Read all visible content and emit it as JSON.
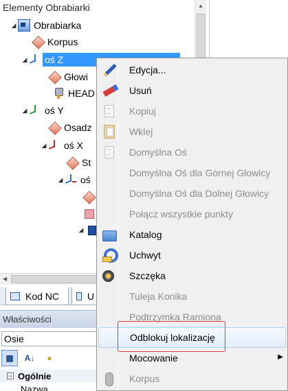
{
  "tree_panel": {
    "title": "Elementy Obrabiarki",
    "nodes": [
      {
        "label": "Obrabiarka"
      },
      {
        "label": "Korpus"
      },
      {
        "label": "oś Z"
      },
      {
        "label": "Głowi"
      },
      {
        "label": "HEAD"
      },
      {
        "label": "oś Y"
      },
      {
        "label": "Osadz"
      },
      {
        "label": "oś X"
      },
      {
        "label": "St"
      },
      {
        "label": "oś"
      }
    ]
  },
  "tabs": [
    {
      "label": "Kod NC"
    },
    {
      "label": "U"
    }
  ],
  "properties": {
    "title": "Właściwości",
    "combo_value": "Osie",
    "category": "Ogólnie",
    "first_item": "Nazwa"
  },
  "context_menu": {
    "items": [
      {
        "label": "Edycja...",
        "icon": "pencil-icon",
        "enabled": true
      },
      {
        "label": "Usuń",
        "icon": "eraser-icon",
        "enabled": true
      },
      {
        "label": "Kopiuj",
        "icon": "copy-icon",
        "enabled": false
      },
      {
        "label": "Wklej",
        "icon": "paste-icon",
        "enabled": false
      },
      {
        "label": "Domyślna Oś",
        "icon": "document-icon",
        "enabled": false
      },
      {
        "label": "Domyślna Oś dla Górnej Głowicy",
        "icon": "",
        "enabled": false
      },
      {
        "label": "Domyślna Oś dla Dolnej Głowicy",
        "icon": "",
        "enabled": false
      },
      {
        "label": "Połącz wszystkie punkty",
        "icon": "",
        "enabled": false
      },
      {
        "label": "Katalog",
        "icon": "folder-icon",
        "enabled": true
      },
      {
        "label": "Uchwyt",
        "icon": "magnet-icon",
        "enabled": true
      },
      {
        "label": "Szczęka",
        "icon": "chuck-icon",
        "enabled": true
      },
      {
        "label": "Tuleja Konika",
        "icon": "",
        "enabled": false
      },
      {
        "label": "Podtrzymka Ramiona",
        "icon": "",
        "enabled": false
      },
      {
        "label": "Odblokuj lokalizację",
        "icon": "",
        "enabled": true,
        "highlighted": true
      },
      {
        "label": "Mocowanie",
        "icon": "",
        "enabled": true,
        "submenu": true
      },
      {
        "label": "Korpus",
        "icon": "korpus-icon",
        "enabled": false
      }
    ]
  },
  "colors": {
    "selection": "#3399ff",
    "highlight_border": "#d93a3a",
    "menu_background": "#f0f0f0",
    "disabled_text": "#8d8d8d"
  }
}
